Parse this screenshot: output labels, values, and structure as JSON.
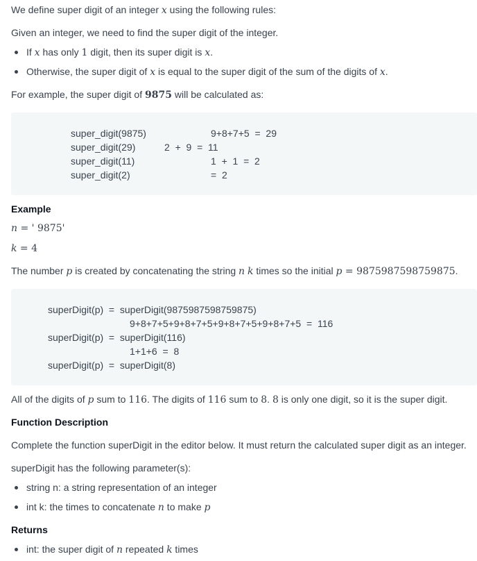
{
  "intro": {
    "definition_prefix": "We define super digit of an integer ",
    "var_x": "x",
    "definition_suffix": " using the following rules:",
    "given": "Given an integer, we need to find the super digit of the integer."
  },
  "rules": [
    {
      "p1": "If ",
      "v1": "x",
      "p2": " has only ",
      "n1": "1",
      "p3": " digit, then its super digit is ",
      "v2": "x",
      "p4": "."
    },
    {
      "p1": "Otherwise, the super digit of ",
      "v1": "x",
      "p2": " is equal to the super digit of the sum of the digits of ",
      "v2": "x",
      "p3": "."
    }
  ],
  "example_intro": {
    "prefix": "For example, the super digit of ",
    "number": "9875",
    "suffix": " will be calculated as:"
  },
  "code1": {
    "left": [
      "super_digit(9875)",
      "super_digit(29)",
      "super_digit(11)",
      "super_digit(2)"
    ],
    "right": [
      "9+8+7+5  =  29",
      "2  +  9  =  11",
      "1  +  1  =  2",
      "=  2"
    ]
  },
  "example": {
    "heading": "Example",
    "n_line": {
      "var": "n",
      "eq": " = ",
      "val": "' 9875'"
    },
    "k_line": {
      "var": "k",
      "eq": " = ",
      "val": "4"
    }
  },
  "concat": {
    "p1": "The number ",
    "v1": "p",
    "p2": " is created by concatenating the string ",
    "v2": "n",
    "p3": " ",
    "v3": "k",
    "p4": " times so the initial ",
    "v4": "p",
    "eq": " = ",
    "val": "9875987598759875",
    "p5": "."
  },
  "code2": {
    "lines": [
      "superDigit(p)  =  superDigit(9875987598759875)",
      "9+8+7+5+9+8+7+5+9+8+7+5+9+8+7+5  =  116",
      "superDigit(p)  =  superDigit(116)",
      "1+1+6  =  8",
      "superDigit(p)  =  superDigit(8)"
    ]
  },
  "summary": {
    "p1": "All of the digits of ",
    "v1": "p",
    "p2": " sum to ",
    "n1": "116",
    "p3": ". The digits of ",
    "n2": "116",
    "p4": " sum to ",
    "n3": "8",
    "p5": ". ",
    "n4": "8",
    "p6": " is only one digit, so it is the super digit."
  },
  "function_description": {
    "heading": "Function Description",
    "text": "Complete the function superDigit in the editor below. It must return the calculated super digit as an integer.",
    "params_intro": "superDigit has the following parameter(s):"
  },
  "params": [
    {
      "text": "string n: a string representation of an integer"
    },
    {
      "p1": "int k: the times to concatenate ",
      "v1": "n",
      "p2": " to make ",
      "v2": "p"
    }
  ],
  "returns": {
    "heading": "Returns",
    "p1": "int: the super digit of ",
    "v1": "n",
    "p2": " repeated ",
    "v2": "k",
    "p3": " times"
  }
}
